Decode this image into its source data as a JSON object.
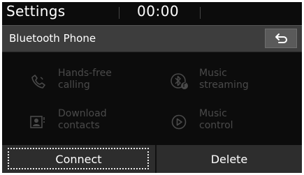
{
  "status_bar": {
    "title": "Settings",
    "time": "00:00"
  },
  "title_bar": {
    "title": "Bluetooth Phone",
    "back_icon": "back-arrow-icon"
  },
  "menu": {
    "items": [
      {
        "label": "Hands-free\ncalling",
        "icon": "phone-icon",
        "enabled": false
      },
      {
        "label": "Music\nstreaming",
        "icon": "bluetooth-audio-icon",
        "enabled": false
      },
      {
        "label": "Download\ncontacts",
        "icon": "contacts-icon",
        "enabled": false
      },
      {
        "label": "Music\ncontrol",
        "icon": "play-icon",
        "enabled": false
      }
    ]
  },
  "buttons": {
    "connect_label": "Connect",
    "delete_label": "Delete"
  },
  "colors": {
    "background": "#0c0c0c",
    "titlebar": "#3d3d3d",
    "disabled_text": "#4a4a4a",
    "text": "#ffffff",
    "focus_ring": "#e8e8e8"
  }
}
